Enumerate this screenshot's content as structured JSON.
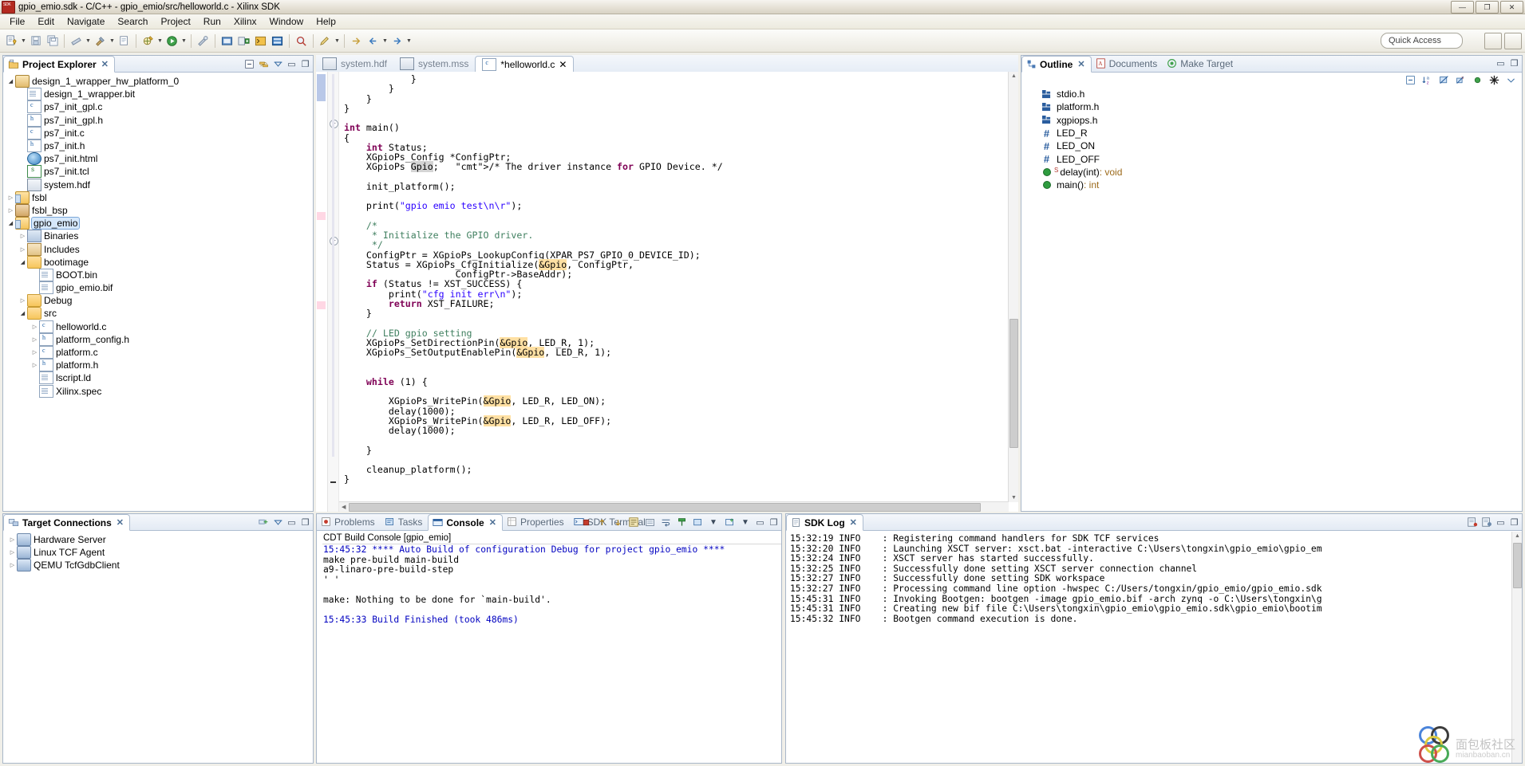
{
  "window": {
    "title": "gpio_emio.sdk - C/C++ - gpio_emio/src/helloworld.c - Xilinx SDK",
    "app_icon": "sdk-icon",
    "buttons": {
      "minimize": "—",
      "maximize": "❐",
      "close": "✕"
    }
  },
  "menu": [
    "File",
    "Edit",
    "Navigate",
    "Search",
    "Project",
    "Run",
    "Xilinx",
    "Window",
    "Help"
  ],
  "toolbar": {
    "quick_access_placeholder": "Quick Access",
    "icons": [
      "new-wizard-icon",
      "save-icon",
      "save-all-icon",
      "print-icon",
      "build-all-icon",
      "build-icon",
      "new-c-project-icon",
      "debug-icon",
      "run-icon",
      "external-tools-icon",
      "program-fpga-icon",
      "create-boot-image-icon",
      "xsct-console-icon",
      "repositories-icon",
      "search-icon"
    ]
  },
  "project_explorer": {
    "tab_label": "Project Explorer",
    "tools": [
      "collapse-all-icon",
      "link-with-editor-icon",
      "view-menu-icon",
      "minimize-icon",
      "maximize-icon"
    ],
    "tree": [
      {
        "label": "design_1_wrapper_hw_platform_0",
        "icon": "hw-platform-icon",
        "indent": 0,
        "arrow": "open"
      },
      {
        "label": "design_1_wrapper.bit",
        "icon": "file-icon",
        "indent": 1,
        "arrow": "none"
      },
      {
        "label": "ps7_init_gpl.c",
        "icon": "c-file-icon",
        "indent": 1,
        "arrow": "none"
      },
      {
        "label": "ps7_init_gpl.h",
        "icon": "h-file-icon",
        "indent": 1,
        "arrow": "none"
      },
      {
        "label": "ps7_init.c",
        "icon": "c-file-icon",
        "indent": 1,
        "arrow": "none"
      },
      {
        "label": "ps7_init.h",
        "icon": "h-file-icon",
        "indent": 1,
        "arrow": "none"
      },
      {
        "label": "ps7_init.html",
        "icon": "html-file-icon",
        "indent": 1,
        "arrow": "none"
      },
      {
        "label": "ps7_init.tcl",
        "icon": "tcl-file-icon",
        "indent": 1,
        "arrow": "none"
      },
      {
        "label": "system.hdf",
        "icon": "hdf-file-icon",
        "indent": 1,
        "arrow": "none"
      },
      {
        "label": "fsbl",
        "icon": "project-folder-icon",
        "indent": 0,
        "arrow": "closed"
      },
      {
        "label": "fsbl_bsp",
        "icon": "bsp-icon",
        "indent": 0,
        "arrow": "closed"
      },
      {
        "label": "gpio_emio",
        "icon": "project-folder-icon",
        "indent": 0,
        "arrow": "open",
        "selected": true
      },
      {
        "label": "Binaries",
        "icon": "binaries-icon",
        "indent": 1,
        "arrow": "closed"
      },
      {
        "label": "Includes",
        "icon": "includes-icon",
        "indent": 1,
        "arrow": "closed"
      },
      {
        "label": "bootimage",
        "icon": "folder-icon",
        "indent": 1,
        "arrow": "open"
      },
      {
        "label": "BOOT.bin",
        "icon": "file-icon",
        "indent": 2,
        "arrow": "none"
      },
      {
        "label": "gpio_emio.bif",
        "icon": "file-icon",
        "indent": 2,
        "arrow": "none"
      },
      {
        "label": "Debug",
        "icon": "folder-icon",
        "indent": 1,
        "arrow": "closed"
      },
      {
        "label": "src",
        "icon": "folder-icon",
        "indent": 1,
        "arrow": "open"
      },
      {
        "label": "helloworld.c",
        "icon": "c-file-icon",
        "indent": 2,
        "arrow": "closed"
      },
      {
        "label": "platform_config.h",
        "icon": "h-file-icon",
        "indent": 2,
        "arrow": "closed"
      },
      {
        "label": "platform.c",
        "icon": "c-file-icon",
        "indent": 2,
        "arrow": "closed"
      },
      {
        "label": "platform.h",
        "icon": "h-file-icon",
        "indent": 2,
        "arrow": "closed"
      },
      {
        "label": "lscript.ld",
        "icon": "file-icon",
        "indent": 2,
        "arrow": "none"
      },
      {
        "label": "Xilinx.spec",
        "icon": "file-icon",
        "indent": 2,
        "arrow": "none"
      }
    ]
  },
  "target_connections": {
    "tab_label": "Target Connections",
    "tools": [
      "new-connection-icon",
      "view-menu-icon",
      "minimize-icon",
      "maximize-icon"
    ],
    "tree": [
      {
        "label": "Hardware Server",
        "icon": "connection-icon",
        "arrow": "closed"
      },
      {
        "label": "Linux TCF Agent",
        "icon": "connection-icon",
        "arrow": "closed"
      },
      {
        "label": "QEMU TcfGdbClient",
        "icon": "connection-icon",
        "arrow": "closed"
      }
    ]
  },
  "editor": {
    "tabs": [
      {
        "label": "system.hdf",
        "icon": "hdf-file-icon",
        "active": false,
        "dirty": false
      },
      {
        "label": "system.mss",
        "icon": "mss-file-icon",
        "active": false,
        "dirty": false
      },
      {
        "label": "*helloworld.c",
        "icon": "c-file-icon",
        "active": true,
        "dirty": true
      }
    ],
    "code_lines": [
      "            }",
      "        }",
      "    }",
      "}",
      "",
      "int main()",
      "{",
      "    int Status;",
      "    XGpioPs_Config *ConfigPtr;",
      "    XGpioPs Gpio;   /* The driver instance for GPIO Device. */",
      "",
      "    init_platform();",
      "",
      "    print(\"gpio emio test\\n\\r\");",
      "",
      "    /*",
      "     * Initialize the GPIO driver.",
      "     */",
      "    ConfigPtr = XGpioPs_LookupConfig(XPAR_PS7_GPIO_0_DEVICE_ID);",
      "    Status = XGpioPs_CfgInitialize(&Gpio, ConfigPtr,",
      "                    ConfigPtr->BaseAddr);",
      "    if (Status != XST_SUCCESS) {",
      "        print(\"cfg init err\\n\");",
      "        return XST_FAILURE;",
      "    }",
      "",
      "    // LED gpio setting",
      "    XGpioPs_SetDirectionPin(&Gpio, LED_R, 1);",
      "    XGpioPs_SetOutputEnablePin(&Gpio, LED_R, 1);",
      "",
      "",
      "    while (1) {",
      "",
      "        XGpioPs_WritePin(&Gpio, LED_R, LED_ON);",
      "        delay(1000);",
      "        XGpioPs_WritePin(&Gpio, LED_R, LED_OFF);",
      "        delay(1000);",
      "",
      "    }",
      "",
      "    cleanup_platform();",
      "}"
    ]
  },
  "outline": {
    "tabs": [
      {
        "label": "Outline",
        "icon": "outline-icon",
        "active": true
      },
      {
        "label": "Documents",
        "icon": "documents-icon",
        "active": false
      },
      {
        "label": "Make Target",
        "icon": "make-target-icon",
        "active": false
      }
    ],
    "tools": [
      "collapse-all-icon",
      "sort-icon",
      "hide-fields-icon",
      "hide-static-icon",
      "hide-nonpublic-icon",
      "hide-macros-icon",
      "view-menu-icon"
    ],
    "items": [
      {
        "label": "stdio.h",
        "kind": "include"
      },
      {
        "label": "platform.h",
        "kind": "include"
      },
      {
        "label": "xgpiops.h",
        "kind": "include"
      },
      {
        "label": "LED_R",
        "kind": "macro"
      },
      {
        "label": "LED_ON",
        "kind": "macro"
      },
      {
        "label": "LED_OFF",
        "kind": "macro"
      },
      {
        "label": "delay(int)",
        "rettype": " : void",
        "kind": "function-static"
      },
      {
        "label": "main()",
        "rettype": " : int",
        "kind": "function"
      }
    ]
  },
  "console": {
    "tabs": [
      {
        "label": "Problems",
        "icon": "problems-icon",
        "active": false
      },
      {
        "label": "Tasks",
        "icon": "tasks-icon",
        "active": false
      },
      {
        "label": "Console",
        "icon": "console-icon",
        "active": true
      },
      {
        "label": "Properties",
        "icon": "properties-icon",
        "active": false
      },
      {
        "label": "SDK Terminal",
        "icon": "sdk-terminal-icon",
        "active": false
      }
    ],
    "tools": [
      "terminate-icon",
      "remove-launch-icon",
      "remove-all-icon",
      "clear-console-icon",
      "scroll-lock-icon",
      "word-wrap-icon",
      "pin-console-icon",
      "display-selected-console-icon",
      "open-console-icon"
    ],
    "title": "CDT Build Console [gpio_emio]",
    "lines": [
      {
        "text": "15:45:32 **** Auto Build of configuration Debug for project gpio_emio ****",
        "color": "blue"
      },
      {
        "text": "make pre-build main-build ",
        "color": "black"
      },
      {
        "text": "a9-linaro-pre-build-step",
        "color": "black"
      },
      {
        "text": "' '",
        "color": "black"
      },
      {
        "text": "",
        "color": "black"
      },
      {
        "text": "make: Nothing to be done for `main-build'.",
        "color": "black"
      },
      {
        "text": "",
        "color": "black"
      },
      {
        "text": "15:45:33 Build Finished (took 486ms)",
        "color": "blue"
      }
    ]
  },
  "sdk_log": {
    "tab_label": "SDK Log",
    "tools": [
      "open-log-file-icon",
      "log-settings-icon",
      "minimize-icon",
      "maximize-icon"
    ],
    "entries": [
      {
        "time": "15:32:19",
        "level": "INFO",
        "message": ": Registering command handlers for SDK TCF services"
      },
      {
        "time": "15:32:20",
        "level": "INFO",
        "message": ": Launching XSCT server: xsct.bat -interactive C:\\Users\\tongxin\\gpio_emio\\gpio_em"
      },
      {
        "time": "15:32:24",
        "level": "INFO",
        "message": ": XSCT server has started successfully."
      },
      {
        "time": "15:32:25",
        "level": "INFO",
        "message": ": Successfully done setting XSCT server connection channel"
      },
      {
        "time": "15:32:27",
        "level": "INFO",
        "message": ": Successfully done setting SDK workspace"
      },
      {
        "time": "15:32:27",
        "level": "INFO",
        "message": ": Processing command line option -hwspec C:/Users/tongxin/gpio_emio/gpio_emio.sdk"
      },
      {
        "time": "15:45:31",
        "level": "INFO",
        "message": ": Invoking Bootgen: bootgen -image gpio_emio.bif -arch zynq -o C:\\Users\\tongxin\\g"
      },
      {
        "time": "15:45:31",
        "level": "INFO",
        "message": ": Creating new bif file C:\\Users\\tongxin\\gpio_emio\\gpio_emio.sdk\\gpio_emio\\bootim"
      },
      {
        "time": "15:45:32",
        "level": "INFO",
        "message": ": Bootgen command execution is done."
      }
    ]
  },
  "watermark": {
    "text": "面包板社区",
    "sub": "mianbaoban.cn"
  },
  "colors": {
    "accent": "#2a5d9e",
    "keyword": "#7f0055",
    "comment": "#3f7f5f",
    "string": "#2a00ff",
    "occurrence_highlight": "#ffe0a3",
    "selection": "#d6e8fb"
  }
}
